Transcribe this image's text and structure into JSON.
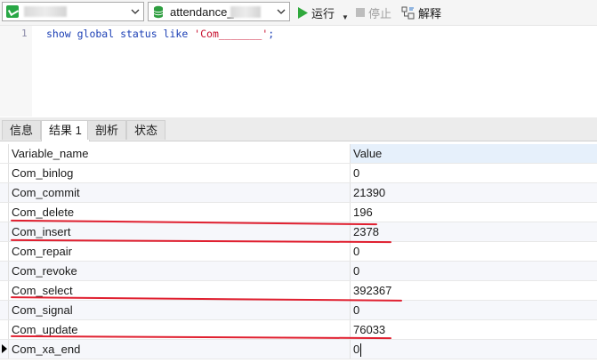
{
  "toolbar": {
    "connection_icon": "connection-icon",
    "database": "attendance_",
    "run_label": "运行",
    "stop_label": "停止",
    "explain_label": "解释"
  },
  "editor": {
    "line_number": "1",
    "code_prefix": "show global status like ",
    "code_string": "'Com_______'",
    "code_suffix": ";"
  },
  "tabs": [
    {
      "label": "信息"
    },
    {
      "label": "结果 1"
    },
    {
      "label": "剖析"
    },
    {
      "label": "状态"
    }
  ],
  "grid": {
    "columns": [
      "Variable_name",
      "Value"
    ],
    "rows": [
      {
        "name": "Com_binlog",
        "value": "0"
      },
      {
        "name": "Com_commit",
        "value": "21390"
      },
      {
        "name": "Com_delete",
        "value": "196"
      },
      {
        "name": "Com_insert",
        "value": "2378"
      },
      {
        "name": "Com_repair",
        "value": "0"
      },
      {
        "name": "Com_revoke",
        "value": "0"
      },
      {
        "name": "Com_select",
        "value": "392367"
      },
      {
        "name": "Com_signal",
        "value": "0"
      },
      {
        "name": "Com_update",
        "value": "76033"
      },
      {
        "name": "Com_xa_end",
        "value": "0"
      }
    ],
    "highlighted_rows": [
      "Com_delete",
      "Com_insert",
      "Com_select",
      "Com_update"
    ],
    "highlight_color": "#e02030"
  }
}
